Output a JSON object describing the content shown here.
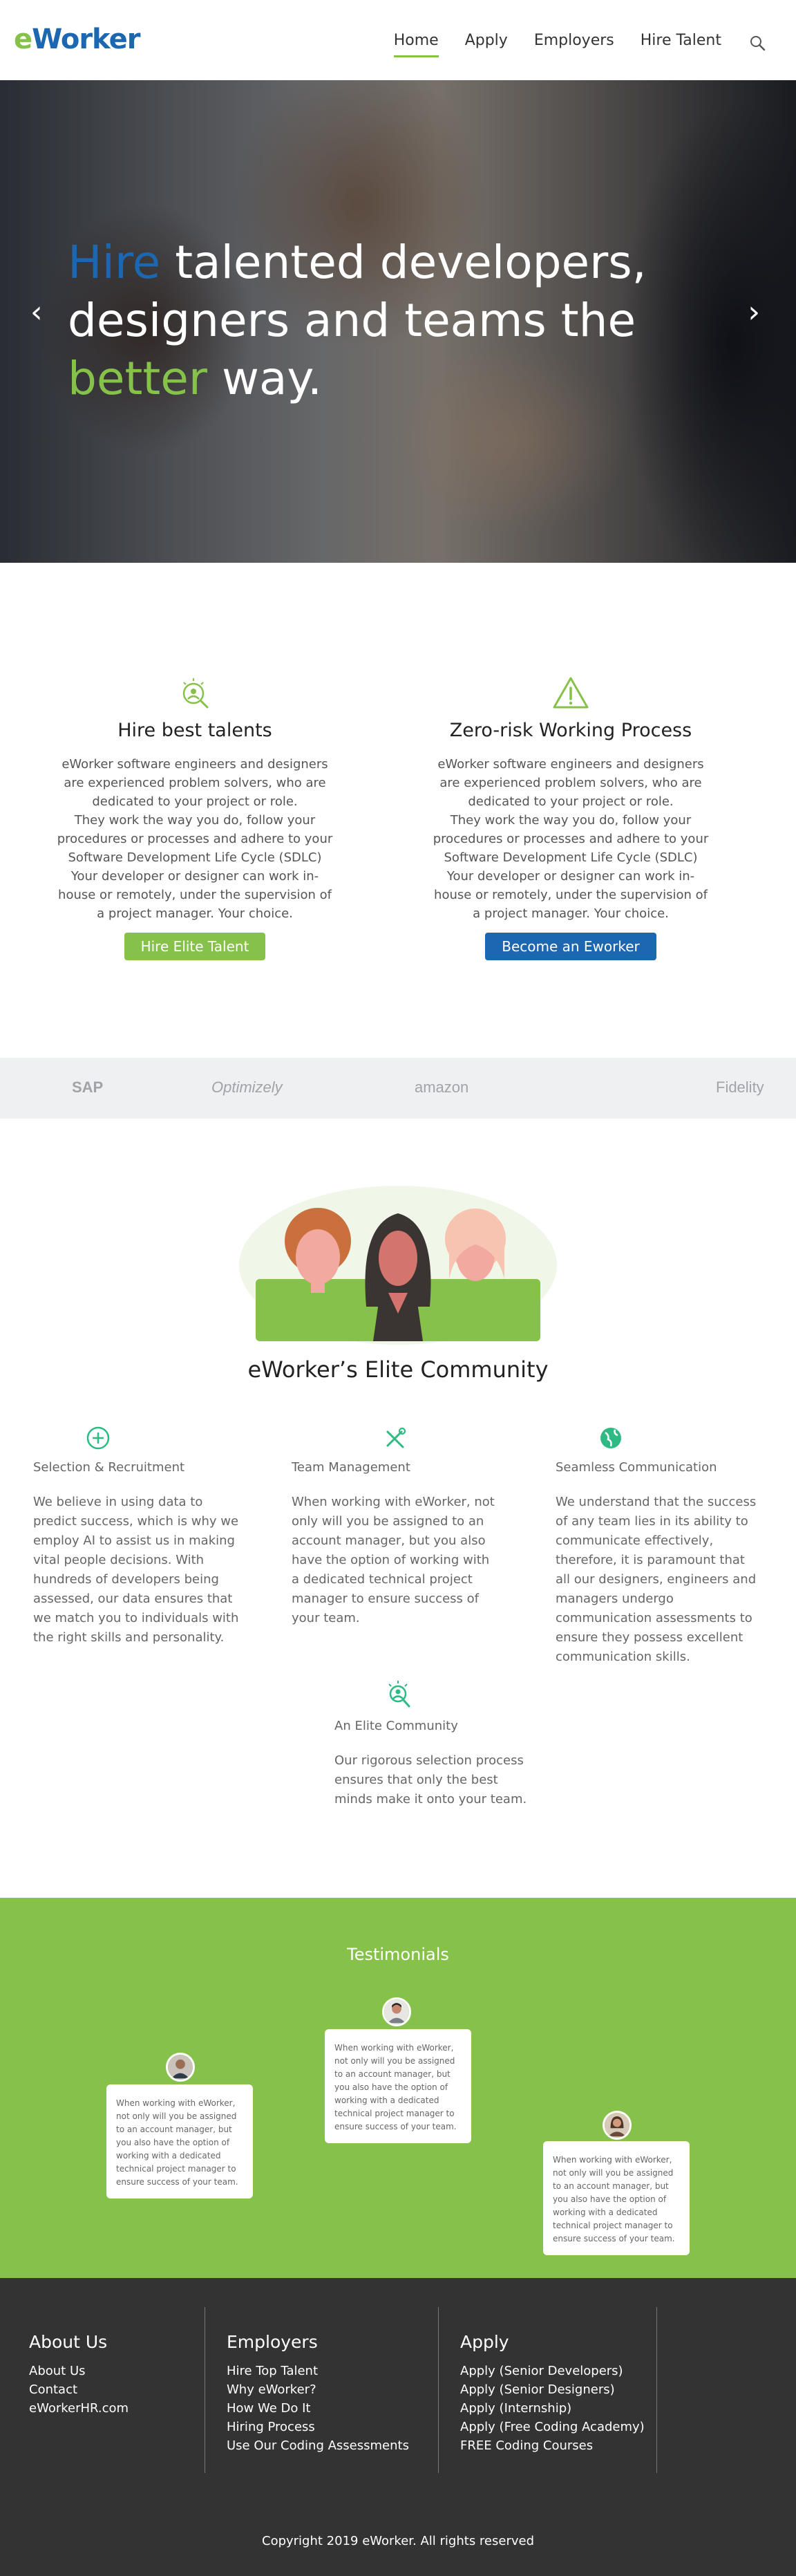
{
  "nav": {
    "logo_e": "e",
    "logo_w": "Worker",
    "items": [
      {
        "label": "Home",
        "active": true
      },
      {
        "label": "Apply"
      },
      {
        "label": "Employers"
      },
      {
        "label": "Hire Talent"
      }
    ],
    "search_icon": "search-icon"
  },
  "hero": {
    "word_hire": "Hire",
    "line1_rest": "talented developers,",
    "line2": "designers and teams the",
    "word_better": "better",
    "line3_rest": "way.",
    "prev_icon": "chevron-left-icon",
    "next_icon": "chevron-right-icon"
  },
  "features": [
    {
      "icon": "talent-search-icon",
      "title": "Hire best talents",
      "p1": "eWorker software engineers and designers are experienced problem solvers, who are dedicated to your project or role.",
      "p2": "They work the way you do, follow your procedures or processes and adhere to your Software Development Life Cycle (SDLC)",
      "p3": "Your developer or designer can work in-house or remotely, under the supervision of a project manager. Your choice.",
      "button": "Hire Elite Talent"
    },
    {
      "icon": "warning-icon",
      "title": "Zero-risk Working Process",
      "p1": "eWorker software engineers and designers are experienced problem solvers, who are dedicated to your project or role.",
      "p2": "They work the way you do, follow your procedures or processes and adhere to your Software Development Life Cycle (SDLC)",
      "p3": "Your developer or designer can work in-house or remotely, under the supervision of a project manager. Your choice.",
      "button": "Become an Eworker"
    }
  ],
  "brands": [
    "SAP",
    "Optimizely",
    "amazon",
    "Fidelity"
  ],
  "community": {
    "title": "eWorker’s Elite Community",
    "cells": [
      {
        "icon": "plus-circle-icon",
        "title": "Selection & Recruitment",
        "text": "We believe in using data to predict success, which is why we employ AI to assist us in making vital people decisions. With hundreds of developers being assessed, our data ensures that we match you to individuals with the right skills and personality."
      },
      {
        "icon": "tools-icon",
        "title": "Team Management",
        "text": "When working with eWorker, not only will you be assigned to an account manager, but you also have the option of working with a dedicated technical project manager to ensure success of your team."
      },
      {
        "icon": "globe-icon",
        "title": "Seamless Communication",
        "text": "We understand that the success of any team lies in its ability to communicate effectively, therefore, it is paramount that all our designers, engineers and managers undergo communication assessments to ensure they possess excellent communication skills."
      },
      {
        "icon": "community-icon",
        "title": "An Elite Community",
        "text": "Our rigorous selection process ensures that only the best minds make it onto your team."
      }
    ]
  },
  "testimonials": {
    "title": "Testimonials",
    "cards": [
      {
        "text": "When working with eWorker, not only will you be assigned to an account manager, but you also have the option of working with a dedicated technical project manager to ensure success of your team."
      },
      {
        "text": "When working with eWorker, not only will you be assigned to an account manager, but you also have the option of working with a dedicated technical project manager to ensure success of your team."
      },
      {
        "text": "When working with eWorker, not only will you be assigned to an account manager, but you also have the option of working with a dedicated technical project manager to ensure success of your team."
      }
    ]
  },
  "footer": {
    "cols": [
      {
        "title": "About Us",
        "links": [
          "About Us",
          "Contact",
          "eWorkerHR.com"
        ]
      },
      {
        "title": "Employers",
        "links": [
          "Hire Top Talent",
          "Why eWorker?",
          "How We Do It",
          "Hiring Process",
          "Use Our Coding Assessments"
        ]
      },
      {
        "title": "Apply",
        "links": [
          "Apply (Senior Developers)",
          "Apply (Senior Designers)",
          "Apply (Internship)",
          "Apply (Free Coding Academy)",
          "FREE Coding Courses"
        ]
      }
    ],
    "copyright": "Copyright 2019 eWorker. All rights reserved"
  },
  "colors": {
    "green": "#86c14a",
    "blue": "#1d67b1",
    "footer": "#333333",
    "strip": "#eef0f2"
  }
}
